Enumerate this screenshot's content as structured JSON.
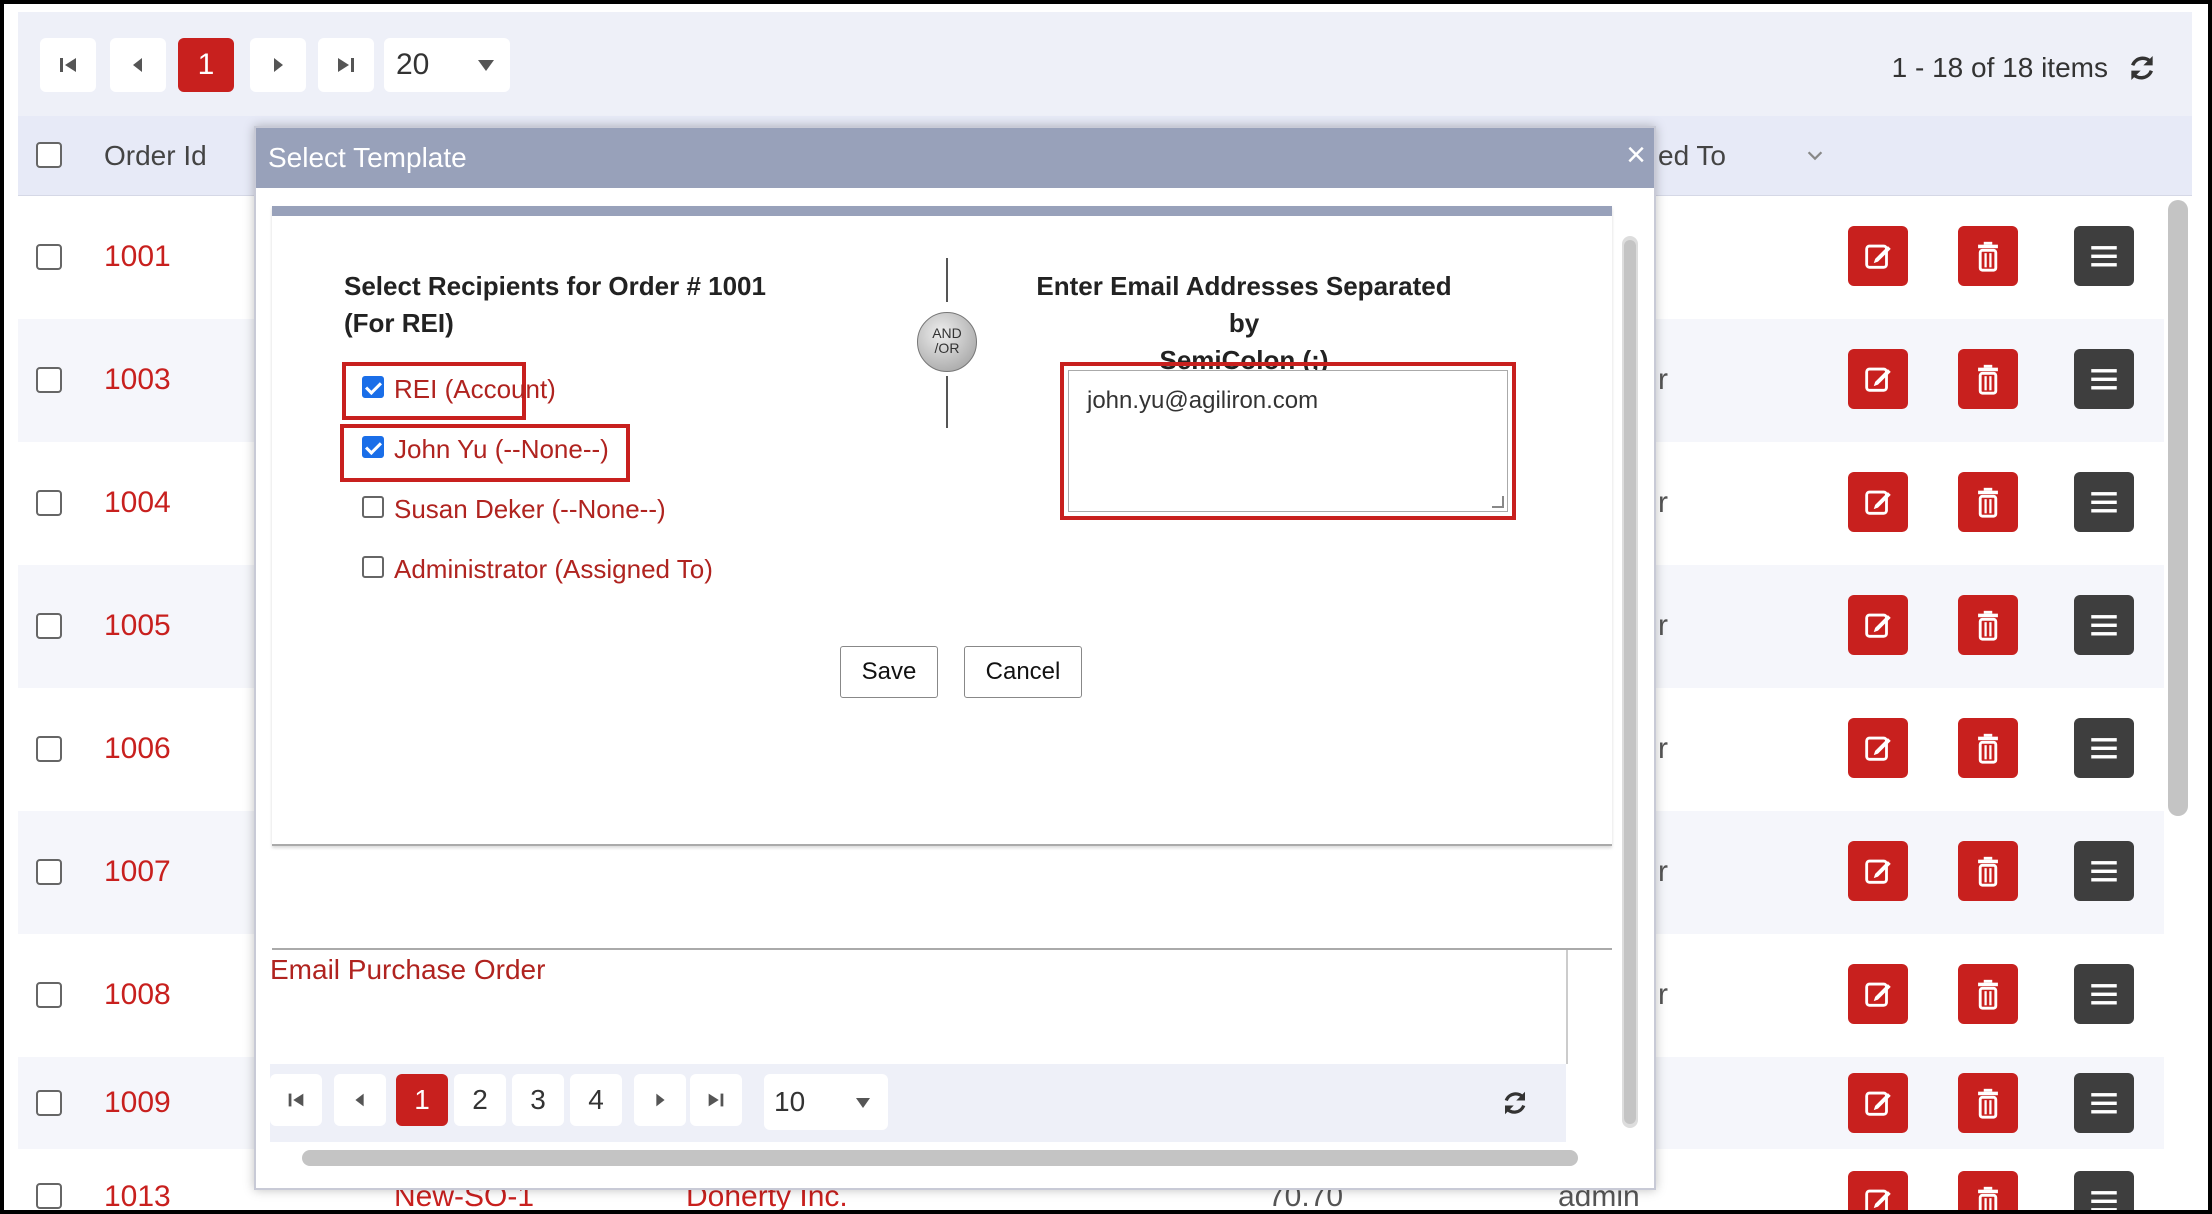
{
  "pager": {
    "current_page": "1",
    "page_size": "20",
    "summary": "1 - 18 of 18 items"
  },
  "grid": {
    "col_order_id": "Order Id",
    "col_assigned_to_partial": "ed To"
  },
  "rows": [
    {
      "order_id": "1001",
      "stub": ""
    },
    {
      "order_id": "1003",
      "stub": "r"
    },
    {
      "order_id": "1004",
      "stub": "r"
    },
    {
      "order_id": "1005",
      "stub": "r"
    },
    {
      "order_id": "1006",
      "stub": "r"
    },
    {
      "order_id": "1007",
      "stub": "r"
    },
    {
      "order_id": "1008",
      "stub": "r"
    },
    {
      "order_id": "1009",
      "stub": ""
    }
  ],
  "last_row": {
    "order_id": "1013",
    "ref": "New-SO-1",
    "customer": "Doherty Inc.",
    "total": "70.70",
    "assigned": "admin"
  },
  "modal": {
    "title": "Select Template",
    "close": "×",
    "recipients_title_line1": "Select Recipients for Order # 1001",
    "recipients_title_line2": "(For REI)",
    "recipients": [
      {
        "label": "REI (Account)",
        "checked": true
      },
      {
        "label": "John Yu (--None--)",
        "checked": true
      },
      {
        "label": "Susan Deker (--None--)",
        "checked": false
      },
      {
        "label": "Administrator (Assigned To)",
        "checked": false
      }
    ],
    "andor_line1": "AND",
    "andor_line2": "/OR",
    "email_title_line1": "Enter Email Addresses Separated by",
    "email_title_line2": "SemiColon (;)",
    "email_value": "john.yu@agiliron.com",
    "save_label": "Save",
    "cancel_label": "Cancel",
    "template_item": "Email Purchase Order",
    "subpager": {
      "pages": [
        "1",
        "2",
        "3",
        "4"
      ],
      "page_size": "10"
    }
  },
  "colors": {
    "accent": "#c8201e",
    "header_bar": "#98a1ba",
    "dark_button": "#3e3e3e"
  }
}
